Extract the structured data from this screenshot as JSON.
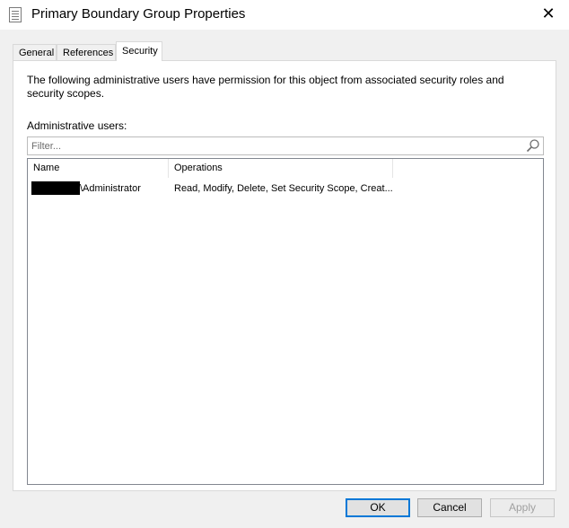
{
  "window": {
    "title": "Primary Boundary Group Properties",
    "close_glyph": "✕"
  },
  "tabs": [
    {
      "label": "General",
      "active": false
    },
    {
      "label": "References",
      "active": false
    },
    {
      "label": "Security",
      "active": true
    }
  ],
  "security": {
    "description": "The following administrative users have permission for this object from associated security roles and security scopes.",
    "admin_users_label": "Administrative users:",
    "filter": {
      "value": "",
      "placeholder": "Filter..."
    },
    "columns": {
      "name": "Name",
      "operations": "Operations"
    },
    "rows": [
      {
        "name_suffix": "\\Administrator",
        "operations": "Read, Modify, Delete, Set Security Scope, Creat..."
      }
    ]
  },
  "buttons": {
    "ok": "OK",
    "cancel": "Cancel",
    "apply": "Apply"
  },
  "colors": {
    "accent": "#0078d7",
    "dialog_bg": "#f0f0f0"
  }
}
